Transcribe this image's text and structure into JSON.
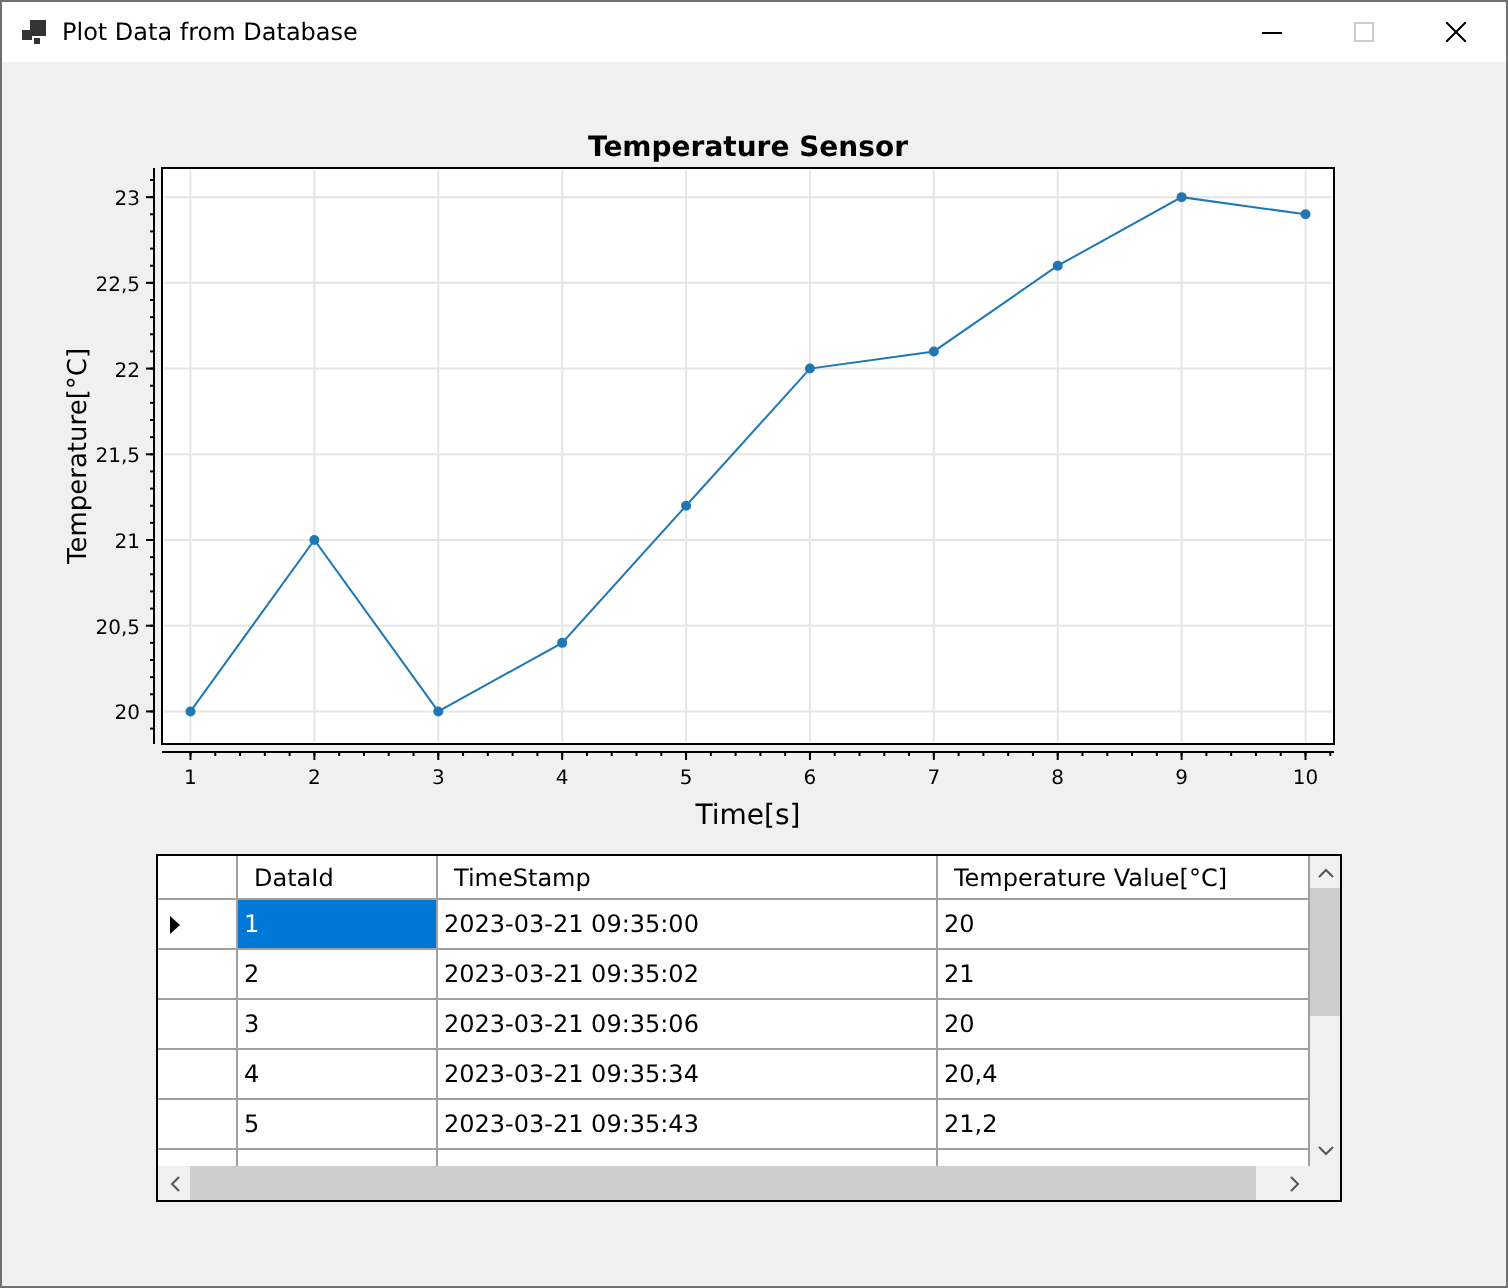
{
  "window": {
    "title": "Plot Data from Database",
    "maximize_disabled": true
  },
  "chart": {
    "chart_data": {
      "type": "line",
      "title": "Temperature Sensor",
      "xlabel": "Time[s]",
      "ylabel": "Temperature[°C]",
      "x": [
        1,
        2,
        3,
        4,
        5,
        6,
        7,
        8,
        9,
        10
      ],
      "grid": true,
      "series": [
        {
          "color": "#1f77b4",
          "marker": true,
          "values": [
            20,
            21,
            20,
            20.4,
            21.2,
            22,
            22.1,
            22.6,
            23,
            22.9
          ]
        }
      ],
      "xlim": [
        0.77,
        10.23
      ],
      "ylim": [
        19.81,
        23.17
      ],
      "xticks": [
        1,
        2,
        3,
        4,
        5,
        6,
        7,
        8,
        9,
        10
      ],
      "yticks": [
        {
          "value": 20,
          "label": "20"
        },
        {
          "value": 20.5,
          "label": "20,5"
        },
        {
          "value": 21,
          "label": "21"
        },
        {
          "value": 21.5,
          "label": "21,5"
        },
        {
          "value": 22,
          "label": "22"
        },
        {
          "value": 22.5,
          "label": "22,5"
        },
        {
          "value": 23,
          "label": "23"
        }
      ]
    }
  },
  "table": {
    "columns": [
      "DataId",
      "TimeStamp",
      "Temperature Value[°C]"
    ],
    "rows": [
      {
        "selected": true,
        "cells": [
          "1",
          "2023-03-21 09:35:00",
          "20"
        ]
      },
      {
        "selected": false,
        "cells": [
          "2",
          "2023-03-21 09:35:02",
          "21"
        ]
      },
      {
        "selected": false,
        "cells": [
          "3",
          "2023-03-21 09:35:06",
          "20"
        ]
      },
      {
        "selected": false,
        "cells": [
          "4",
          "2023-03-21 09:35:34",
          "20,4"
        ]
      },
      {
        "selected": false,
        "cells": [
          "5",
          "2023-03-21 09:35:43",
          "21,2"
        ]
      }
    ]
  }
}
